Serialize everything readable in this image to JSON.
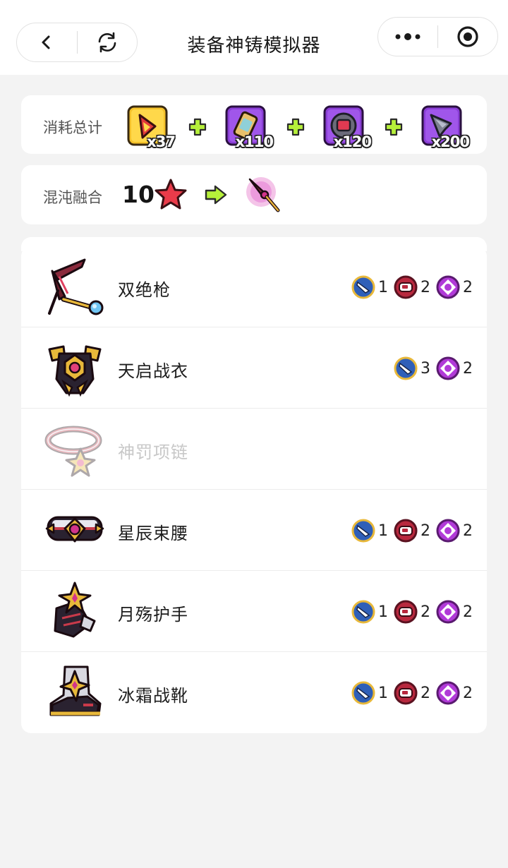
{
  "header": {
    "title": "装备神铸模拟器"
  },
  "cost": {
    "label": "消耗总计",
    "materials": [
      {
        "icon": "red-crystal-material-icon",
        "count": "x37"
      },
      {
        "icon": "scroll-material-icon",
        "count": "x110"
      },
      {
        "icon": "red-gem-material-icon",
        "count": "x120"
      },
      {
        "icon": "spike-material-icon",
        "count": "x200"
      }
    ]
  },
  "fusion": {
    "label": "混沌融合",
    "count": "10",
    "star_icon": "red-star-icon",
    "result_icon": "chaos-weapon-icon"
  },
  "equipment": [
    {
      "name": "双绝枪",
      "icon": "spear-icon",
      "enabled": true,
      "badges": [
        {
          "type": "blue-blade",
          "count": "1"
        },
        {
          "type": "red-ring",
          "count": "2"
        },
        {
          "type": "purple-gem",
          "count": "2"
        }
      ]
    },
    {
      "name": "天启战衣",
      "icon": "armor-icon",
      "enabled": true,
      "badges": [
        {
          "type": "blue-blade",
          "count": "3"
        },
        {
          "type": "purple-gem",
          "count": "2"
        }
      ]
    },
    {
      "name": "神罚项链",
      "icon": "necklace-icon",
      "enabled": false,
      "badges": []
    },
    {
      "name": "星辰束腰",
      "icon": "belt-icon",
      "enabled": true,
      "badges": [
        {
          "type": "blue-blade",
          "count": "1"
        },
        {
          "type": "red-ring",
          "count": "2"
        },
        {
          "type": "purple-gem",
          "count": "2"
        }
      ]
    },
    {
      "name": "月殇护手",
      "icon": "gauntlet-icon",
      "enabled": true,
      "badges": [
        {
          "type": "blue-blade",
          "count": "1"
        },
        {
          "type": "red-ring",
          "count": "2"
        },
        {
          "type": "purple-gem",
          "count": "2"
        }
      ]
    },
    {
      "name": "冰霜战靴",
      "icon": "boots-icon",
      "enabled": true,
      "badges": [
        {
          "type": "blue-blade",
          "count": "1"
        },
        {
          "type": "red-ring",
          "count": "2"
        },
        {
          "type": "purple-gem",
          "count": "2"
        }
      ]
    }
  ]
}
